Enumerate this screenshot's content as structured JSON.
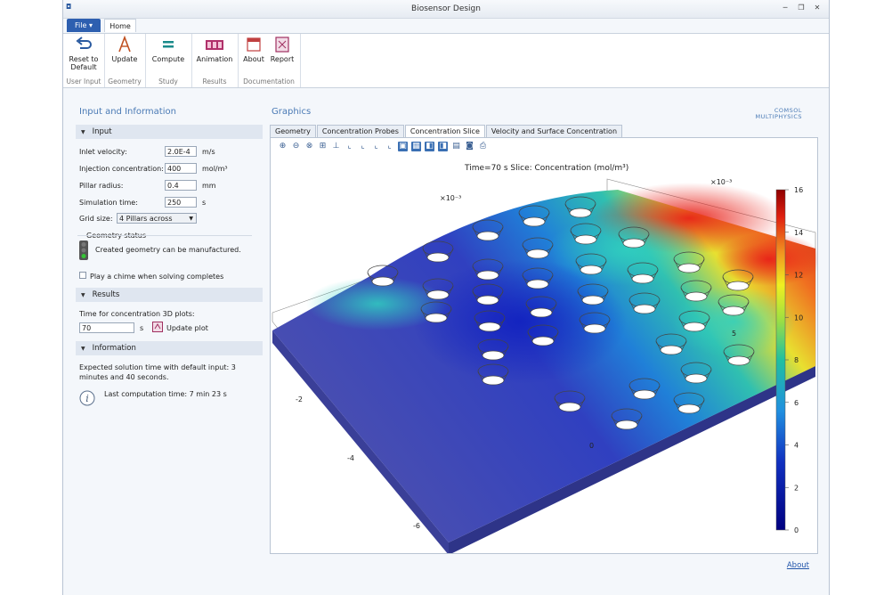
{
  "window": {
    "title": "Biosensor Design",
    "controls": [
      "─",
      "❐",
      "✕"
    ]
  },
  "ribbon": {
    "file_tab": "File ▾",
    "home_tab": "Home",
    "buttons": {
      "reset": "Reset to Default",
      "update": "Update",
      "compute": "Compute",
      "animation": "Animation",
      "about": "About",
      "report": "Report"
    },
    "groups": {
      "user_input": "User Input",
      "geometry": "Geometry",
      "study": "Study",
      "results": "Results",
      "documentation": "Documentation"
    }
  },
  "left": {
    "title": "Input and Information",
    "input_section": "Input",
    "inlet_velocity_label": "Inlet velocity:",
    "inlet_velocity_value": "2.0E-4",
    "inlet_velocity_unit": "m/s",
    "injection_label": "Injection concentration:",
    "injection_value": "400",
    "injection_unit": "mol/m³",
    "pillar_label": "Pillar radius:",
    "pillar_value": "0.4",
    "pillar_unit": "mm",
    "sim_label": "Simulation time:",
    "sim_value": "250",
    "sim_unit": "s",
    "grid_label": "Grid size:",
    "grid_value": "4 Pillars across",
    "geometry_status_title": "Geometry status",
    "geometry_status_text": "Created geometry can be manufactured.",
    "chime_label": "Play a chime when solving completes",
    "results_section": "Results",
    "time_plots_label": "Time for concentration 3D plots:",
    "time_plots_value": "70",
    "time_plots_unit": "s",
    "update_plot": "Update plot",
    "information_section": "Information",
    "expected_text": "Expected solution time with default input: 3 minutes and 40 seconds.",
    "last_computation": "Last computation time: 7 min 23 s"
  },
  "graphics": {
    "title": "Graphics",
    "brand_line1": "COMSOL",
    "brand_line2": "MULTIPHYSICS",
    "tabs": [
      "Geometry",
      "Concentration Probes",
      "Concentration Slice",
      "Velocity and Surface Concentration"
    ],
    "active_tab": 2,
    "plot_title": "Time=70 s   Slice: Concentration (mol/m³)",
    "axis_exp_left": "×10⁻³",
    "axis_exp_right": "×10⁻³",
    "axis_ticks": [
      "-2",
      "-4",
      "-6",
      "0",
      "5"
    ],
    "colorbar_ticks": [
      "16",
      "14",
      "12",
      "10",
      "8",
      "6",
      "4",
      "2",
      "0"
    ],
    "colorbar_range": [
      0,
      16
    ]
  },
  "about_link": "About",
  "colors": {
    "accent": "#4a7ab5",
    "file_tab": "#2d5fb0",
    "surface_base": "#4a4fb0"
  }
}
